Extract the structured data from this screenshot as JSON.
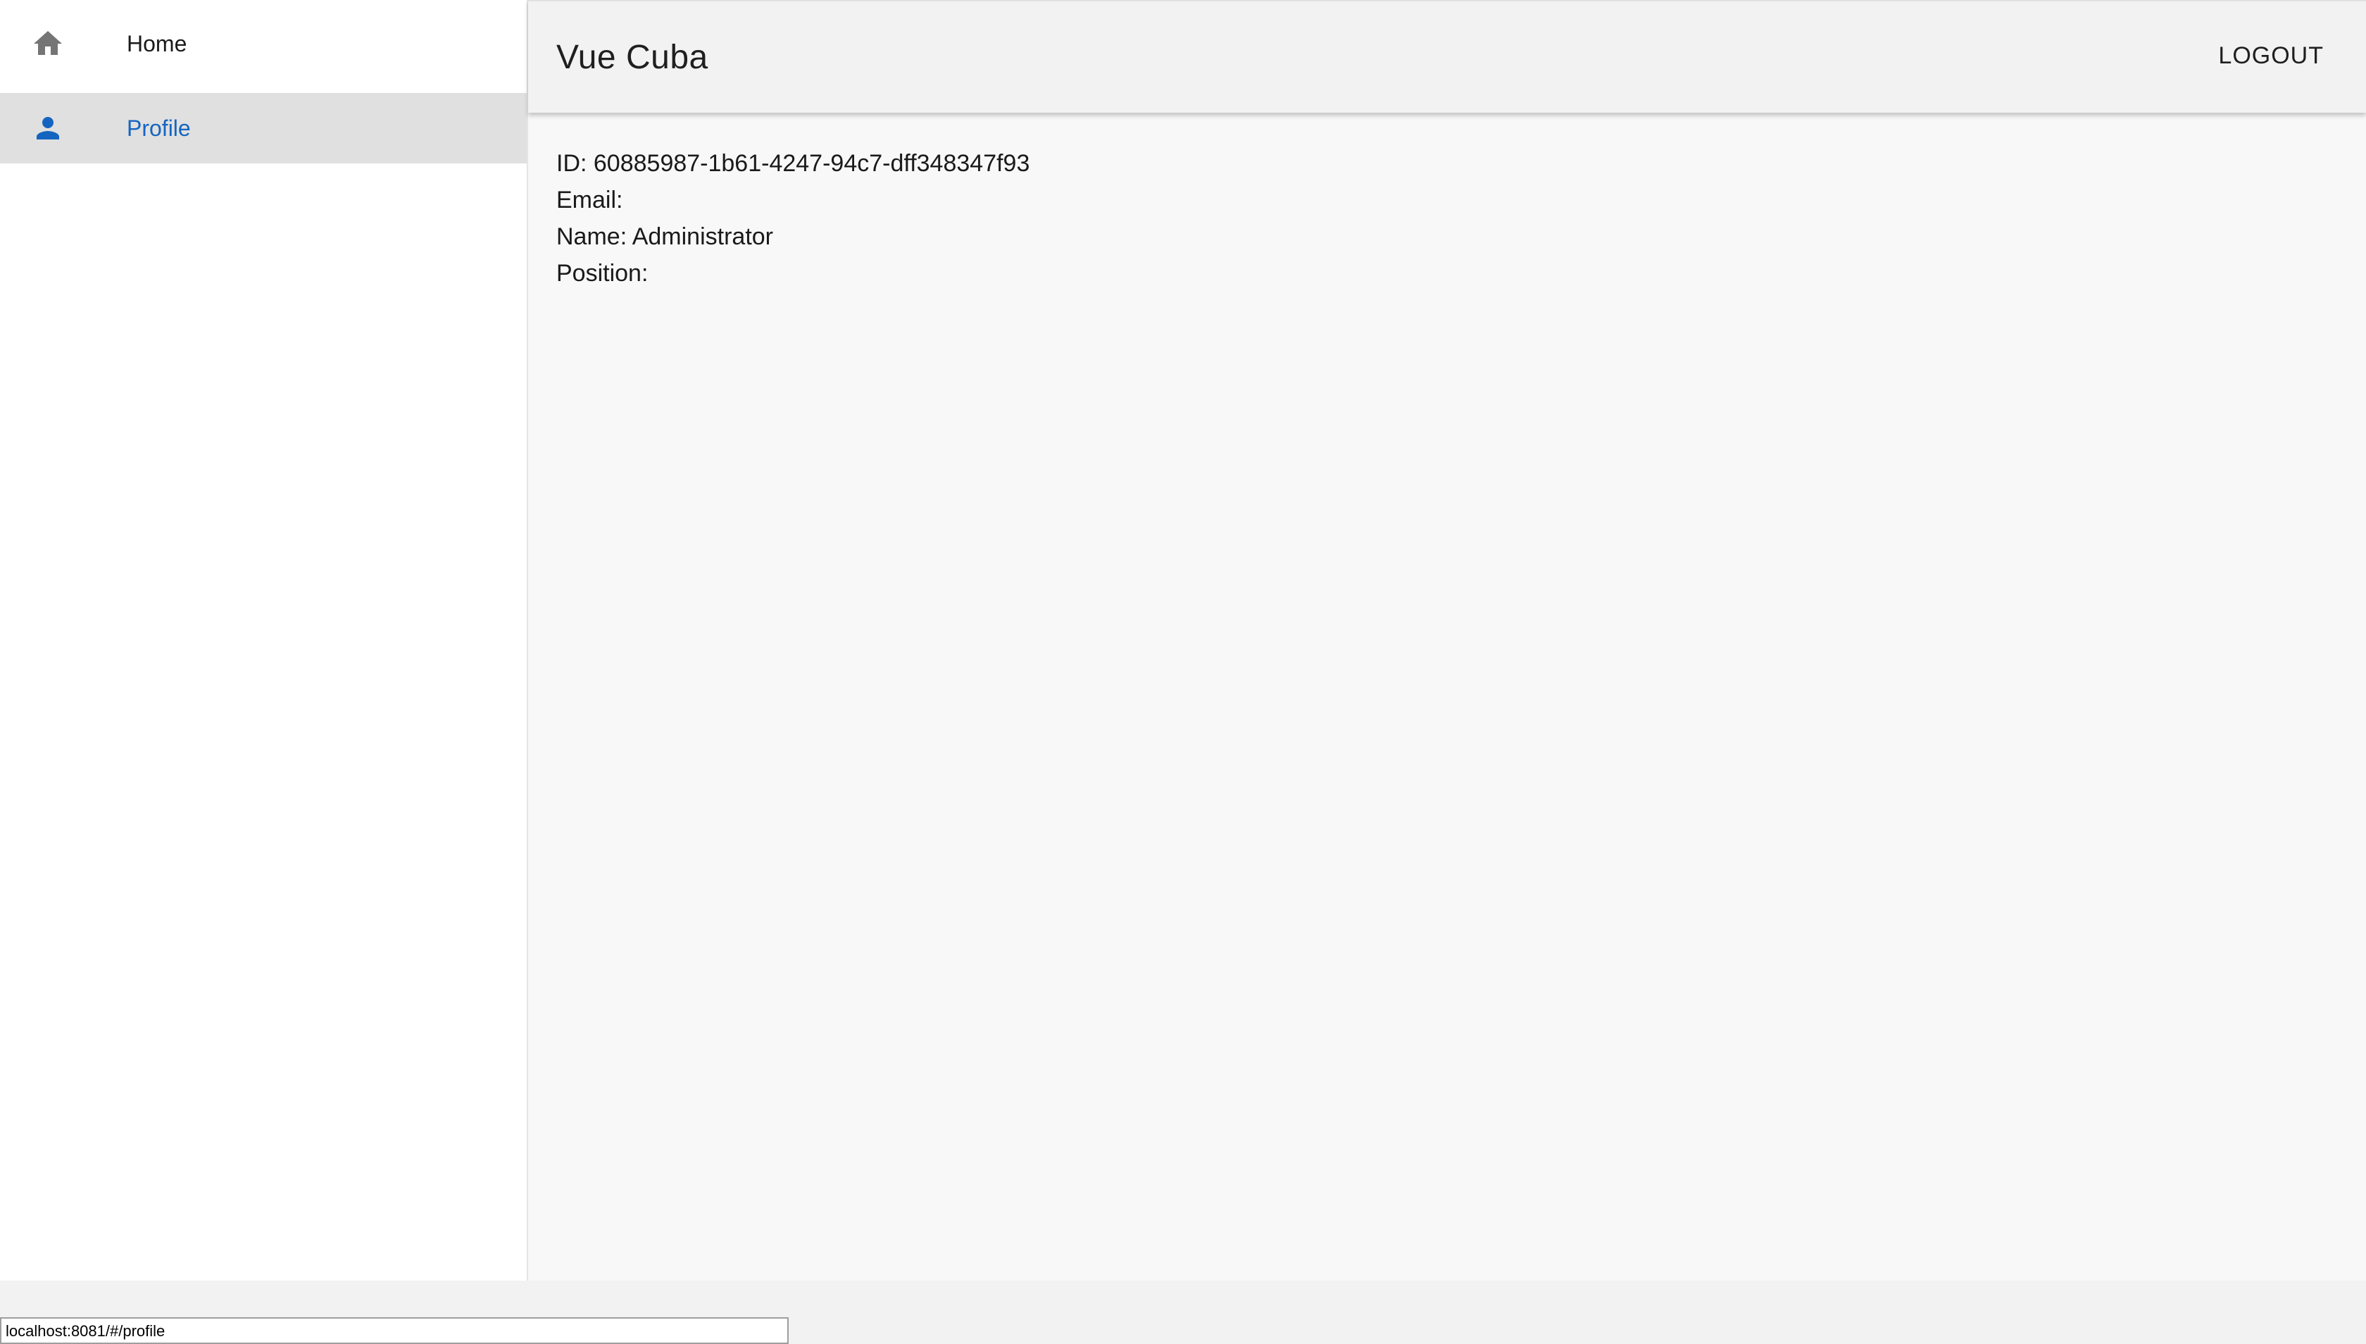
{
  "sidebar": {
    "items": [
      {
        "label": "Home",
        "icon": "home-icon",
        "active": false
      },
      {
        "label": "Profile",
        "icon": "person-icon",
        "active": true
      }
    ]
  },
  "header": {
    "title": "Vue Cuba",
    "logout_label": "LOGOUT"
  },
  "profile": {
    "id_line": "ID: 60885987-1b61-4247-94c7-dff348347f93",
    "email_line": "Email:",
    "name_line": "Name: Administrator",
    "position_line": "Position:"
  },
  "status_bar": {
    "url": "localhost:8081/#/profile"
  },
  "colors": {
    "active_accent": "#1565c0",
    "active_row_bg": "#e0e0e0",
    "header_bg": "#f2f2f2",
    "icon_gray": "#757575"
  }
}
